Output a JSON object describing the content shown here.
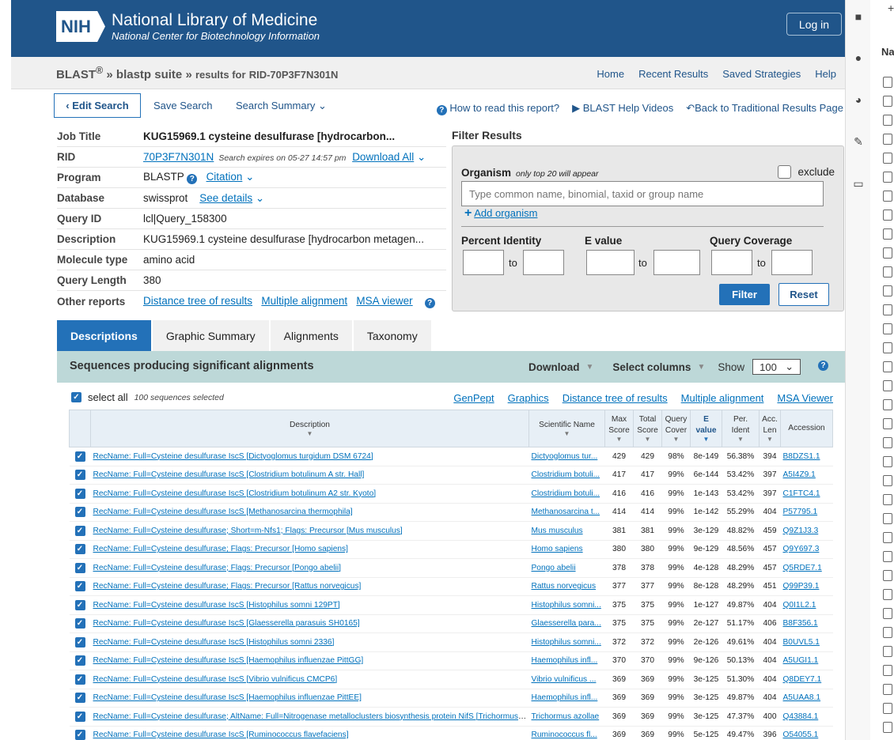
{
  "header": {
    "logo_badge": "NIH",
    "logo_title": "National Library of Medicine",
    "logo_subtitle": "National Center for Biotechnology Information",
    "login": "Log in"
  },
  "breadcrumb": {
    "blast": "BLAST",
    "sup": "®",
    "sep": "»",
    "suite": "blastp suite",
    "results": "results for",
    "rid": "RID-70P3F7N301N"
  },
  "topnav": [
    "Home",
    "Recent Results",
    "Saved Strategies",
    "Help"
  ],
  "actions": {
    "edit_search": "Edit Search",
    "save_search": "Save Search",
    "search_summary": "Search Summary",
    "how_to_read": "How to read this report?",
    "help_videos": "BLAST Help Videos",
    "back": "Back to Traditional Results Page"
  },
  "job": {
    "job_title_label": "Job Title",
    "job_title": "KUG15969.1 cysteine desulfurase [hydrocarbon...",
    "rid_label": "RID",
    "rid": "70P3F7N301N",
    "expires": "Search expires on 05-27 14:57 pm",
    "download_all": "Download All",
    "program_label": "Program",
    "program": "BLASTP",
    "citation": "Citation",
    "database_label": "Database",
    "database": "swissprot",
    "see_details": "See details",
    "query_id_label": "Query ID",
    "query_id": "lcl|Query_158300",
    "description_label": "Description",
    "description": "KUG15969.1 cysteine desulfurase [hydrocarbon metagen...",
    "molecule_label": "Molecule type",
    "molecule": "amino acid",
    "length_label": "Query Length",
    "length": "380",
    "other_label": "Other reports",
    "other_links": [
      "Distance tree of results",
      "Multiple alignment",
      "MSA viewer"
    ]
  },
  "filter": {
    "title": "Filter Results",
    "organism_label": "Organism",
    "organism_note": "only top 20 will appear",
    "exclude": "exclude",
    "organism_placeholder": "Type common  name, binomial, taxid or group  name",
    "add_organism": "Add organism",
    "pct_identity": "Percent Identity",
    "evalue": "E value",
    "query_coverage": "Query Coverage",
    "to": "to",
    "filter_button": "Filter",
    "reset_button": "Reset"
  },
  "tabs": [
    "Descriptions",
    "Graphic Summary",
    "Alignments",
    "Taxonomy"
  ],
  "panel": {
    "title": "Sequences producing significant alignments",
    "download": "Download",
    "select_columns": "Select columns",
    "show": "Show",
    "show_value": "100"
  },
  "selection": {
    "select_all": "select all",
    "count": "100 sequences selected",
    "links": [
      "GenPept",
      "Graphics",
      "Distance tree of results",
      "Multiple alignment",
      "MSA Viewer"
    ]
  },
  "table": {
    "headers": {
      "description": "Description",
      "scientific_name": "Scientific Name",
      "max_score_1": "Max",
      "max_score_2": "Score",
      "total_score_1": "Total",
      "total_score_2": "Score",
      "query_cover_1": "Query",
      "query_cover_2": "Cover",
      "evalue_1": "E",
      "evalue_2": "value",
      "per_ident_1": "Per.",
      "per_ident_2": "Ident",
      "acc_len_1": "Acc.",
      "acc_len_2": "Len",
      "accession": "Accession"
    },
    "rows": [
      [
        "RecName: Full=Cysteine desulfurase IscS [Dictyoglomus turgidum DSM 6724]",
        "Dictyoglomus tur...",
        "429",
        "429",
        "98%",
        "8e-149",
        "56.38%",
        "394",
        "B8DZS1.1"
      ],
      [
        "RecName: Full=Cysteine desulfurase IscS [Clostridium botulinum A str. Hall]",
        "Clostridium botuli...",
        "417",
        "417",
        "99%",
        "6e-144",
        "53.42%",
        "397",
        "A5I4Z9.1"
      ],
      [
        "RecName: Full=Cysteine desulfurase IscS [Clostridium botulinum A2 str. Kyoto]",
        "Clostridium botuli...",
        "416",
        "416",
        "99%",
        "1e-143",
        "53.42%",
        "397",
        "C1FTC4.1"
      ],
      [
        "RecName: Full=Cysteine desulfurase IscS [Methanosarcina thermophila]",
        "Methanosarcina t...",
        "414",
        "414",
        "99%",
        "1e-142",
        "55.29%",
        "404",
        "P57795.1"
      ],
      [
        "RecName: Full=Cysteine desulfurase; Short=m-Nfs1; Flags: Precursor [Mus musculus]",
        "Mus musculus",
        "381",
        "381",
        "99%",
        "3e-129",
        "48.82%",
        "459",
        "Q9Z1J3.3"
      ],
      [
        "RecName: Full=Cysteine desulfurase; Flags: Precursor [Homo sapiens]",
        "Homo sapiens",
        "380",
        "380",
        "99%",
        "9e-129",
        "48.56%",
        "457",
        "Q9Y697.3"
      ],
      [
        "RecName: Full=Cysteine desulfurase; Flags: Precursor [Pongo abelii]",
        "Pongo abelii",
        "378",
        "378",
        "99%",
        "4e-128",
        "48.29%",
        "457",
        "Q5RDE7.1"
      ],
      [
        "RecName: Full=Cysteine desulfurase; Flags: Precursor [Rattus norvegicus]",
        "Rattus norvegicus",
        "377",
        "377",
        "99%",
        "8e-128",
        "48.29%",
        "451",
        "Q99P39.1"
      ],
      [
        "RecName: Full=Cysteine desulfurase IscS [Histophilus somni 129PT]",
        "Histophilus somni...",
        "375",
        "375",
        "99%",
        "1e-127",
        "49.87%",
        "404",
        "Q0I1L2.1"
      ],
      [
        "RecName: Full=Cysteine desulfurase IscS [Glaesserella parasuis SH0165]",
        "Glaesserella para...",
        "375",
        "375",
        "99%",
        "2e-127",
        "51.17%",
        "406",
        "B8F356.1"
      ],
      [
        "RecName: Full=Cysteine desulfurase IscS [Histophilus somni 2336]",
        "Histophilus somni...",
        "372",
        "372",
        "99%",
        "2e-126",
        "49.61%",
        "404",
        "B0UVL5.1"
      ],
      [
        "RecName: Full=Cysteine desulfurase IscS [Haemophilus influenzae PittGG]",
        "Haemophilus infl...",
        "370",
        "370",
        "99%",
        "9e-126",
        "50.13%",
        "404",
        "A5UGI1.1"
      ],
      [
        "RecName: Full=Cysteine desulfurase IscS [Vibrio vulnificus CMCP6]",
        "Vibrio vulnificus ...",
        "369",
        "369",
        "99%",
        "3e-125",
        "51.30%",
        "404",
        "Q8DEY7.1"
      ],
      [
        "RecName: Full=Cysteine desulfurase IscS [Haemophilus influenzae PittEE]",
        "Haemophilus infl...",
        "369",
        "369",
        "99%",
        "3e-125",
        "49.87%",
        "404",
        "A5UAA8.1"
      ],
      [
        "RecName: Full=Cysteine desulfurase; AltName: Full=Nitrogenase metalloclusters biosynthesis protein NifS [Trichormus azollae]",
        "Trichormus azollae",
        "369",
        "369",
        "99%",
        "3e-125",
        "47.37%",
        "400",
        "Q43884.1"
      ],
      [
        "RecName: Full=Cysteine desulfurase IscS [Ruminococcus flavefaciens]",
        "Ruminococcus fl...",
        "369",
        "369",
        "99%",
        "5e-125",
        "49.47%",
        "396",
        "O54055.1"
      ]
    ]
  },
  "sidebar_strip": {
    "label": "Na",
    "plus": "+"
  }
}
